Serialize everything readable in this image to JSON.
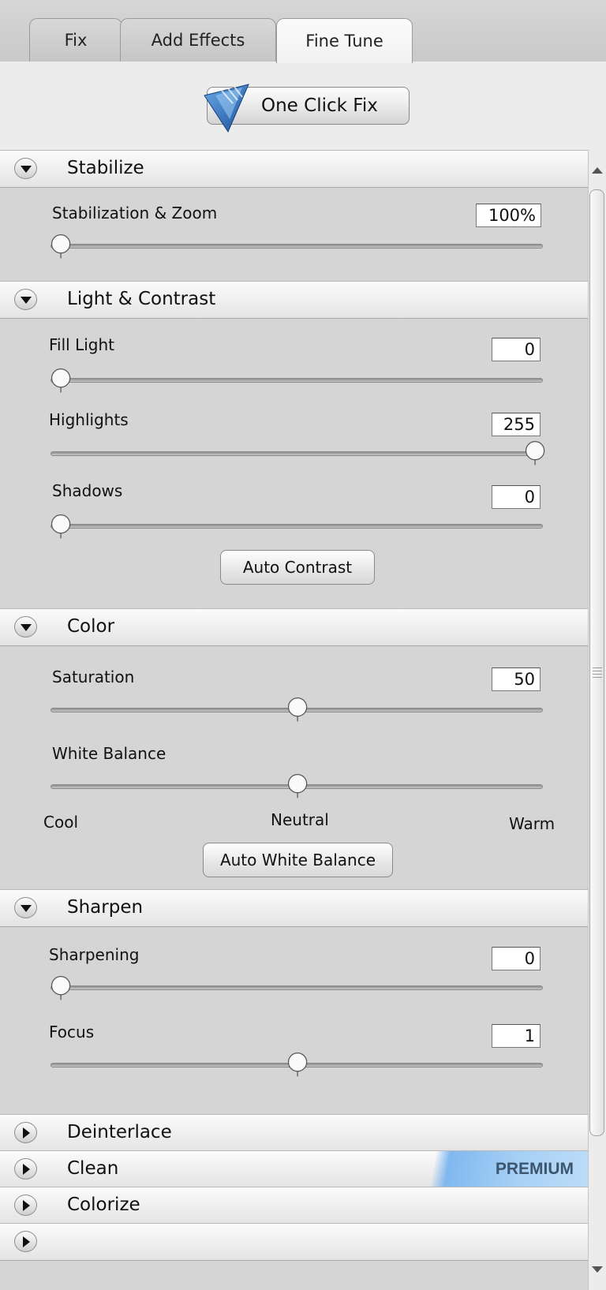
{
  "tabs": [
    {
      "label": "Fix"
    },
    {
      "label": "Add Effects"
    },
    {
      "label": "Fine Tune",
      "active": true
    }
  ],
  "toolbar": {
    "one_click_fix": "One Click Fix"
  },
  "sections": {
    "stabilize": {
      "title": "Stabilize",
      "controls": [
        {
          "label": "Stabilization & Zoom",
          "value": "100%",
          "level": 0
        }
      ]
    },
    "light": {
      "title": "Light & Contrast",
      "controls": [
        {
          "label": "Fill Light",
          "value": "0",
          "level": 0
        },
        {
          "label": "Highlights",
          "value": "255",
          "level": 1
        },
        {
          "label": "Shadows",
          "value": "0",
          "level": 0
        }
      ],
      "button": "Auto Contrast"
    },
    "color": {
      "title": "Color",
      "saturation": {
        "label": "Saturation",
        "value": "50",
        "level": 0.5
      },
      "white_balance": {
        "label": "White Balance",
        "level": 0.5,
        "cool": "Cool",
        "neutral": "Neutral",
        "warm": "Warm"
      },
      "button": "Auto White Balance"
    },
    "sharpen": {
      "title": "Sharpen",
      "controls": [
        {
          "label": "Sharpening",
          "value": "0",
          "level": 0
        },
        {
          "label": "Focus",
          "value": "1",
          "level": 0.5
        }
      ]
    },
    "deinterlace": {
      "title": "Deinterlace"
    },
    "clean": {
      "title": "Clean",
      "badge": "PREMIUM"
    },
    "colorize": {
      "title": "Colorize"
    }
  }
}
